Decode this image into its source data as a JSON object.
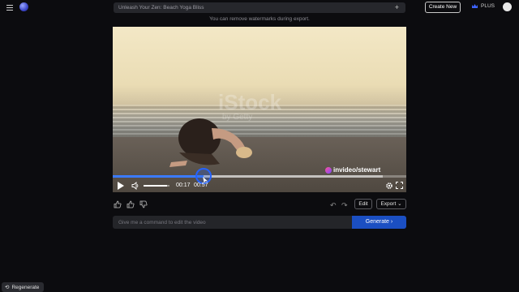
{
  "header": {
    "project_title": "Unleash Your Zen: Beach Yoga Bliss",
    "create_new_label": "Create New",
    "plan_label": "PLUS"
  },
  "notice_text": "You can remove watermarks during export.",
  "video": {
    "watermark": "iStock",
    "watermark_sub": "by Getty",
    "handle": "invideo/stewart",
    "current_time": "00:17",
    "duration": "00:57",
    "progress": 0.31,
    "buffered": 0.92,
    "volume": 0.9
  },
  "actions": {
    "edit_label": "Edit",
    "export_label": "Export"
  },
  "command": {
    "placeholder": "Give me a command to edit the video",
    "generate_label": "Generate"
  },
  "regenerate_label": "Regenerate",
  "colors": {
    "accent": "#1b4fc2",
    "progress": "#3b7bff"
  }
}
